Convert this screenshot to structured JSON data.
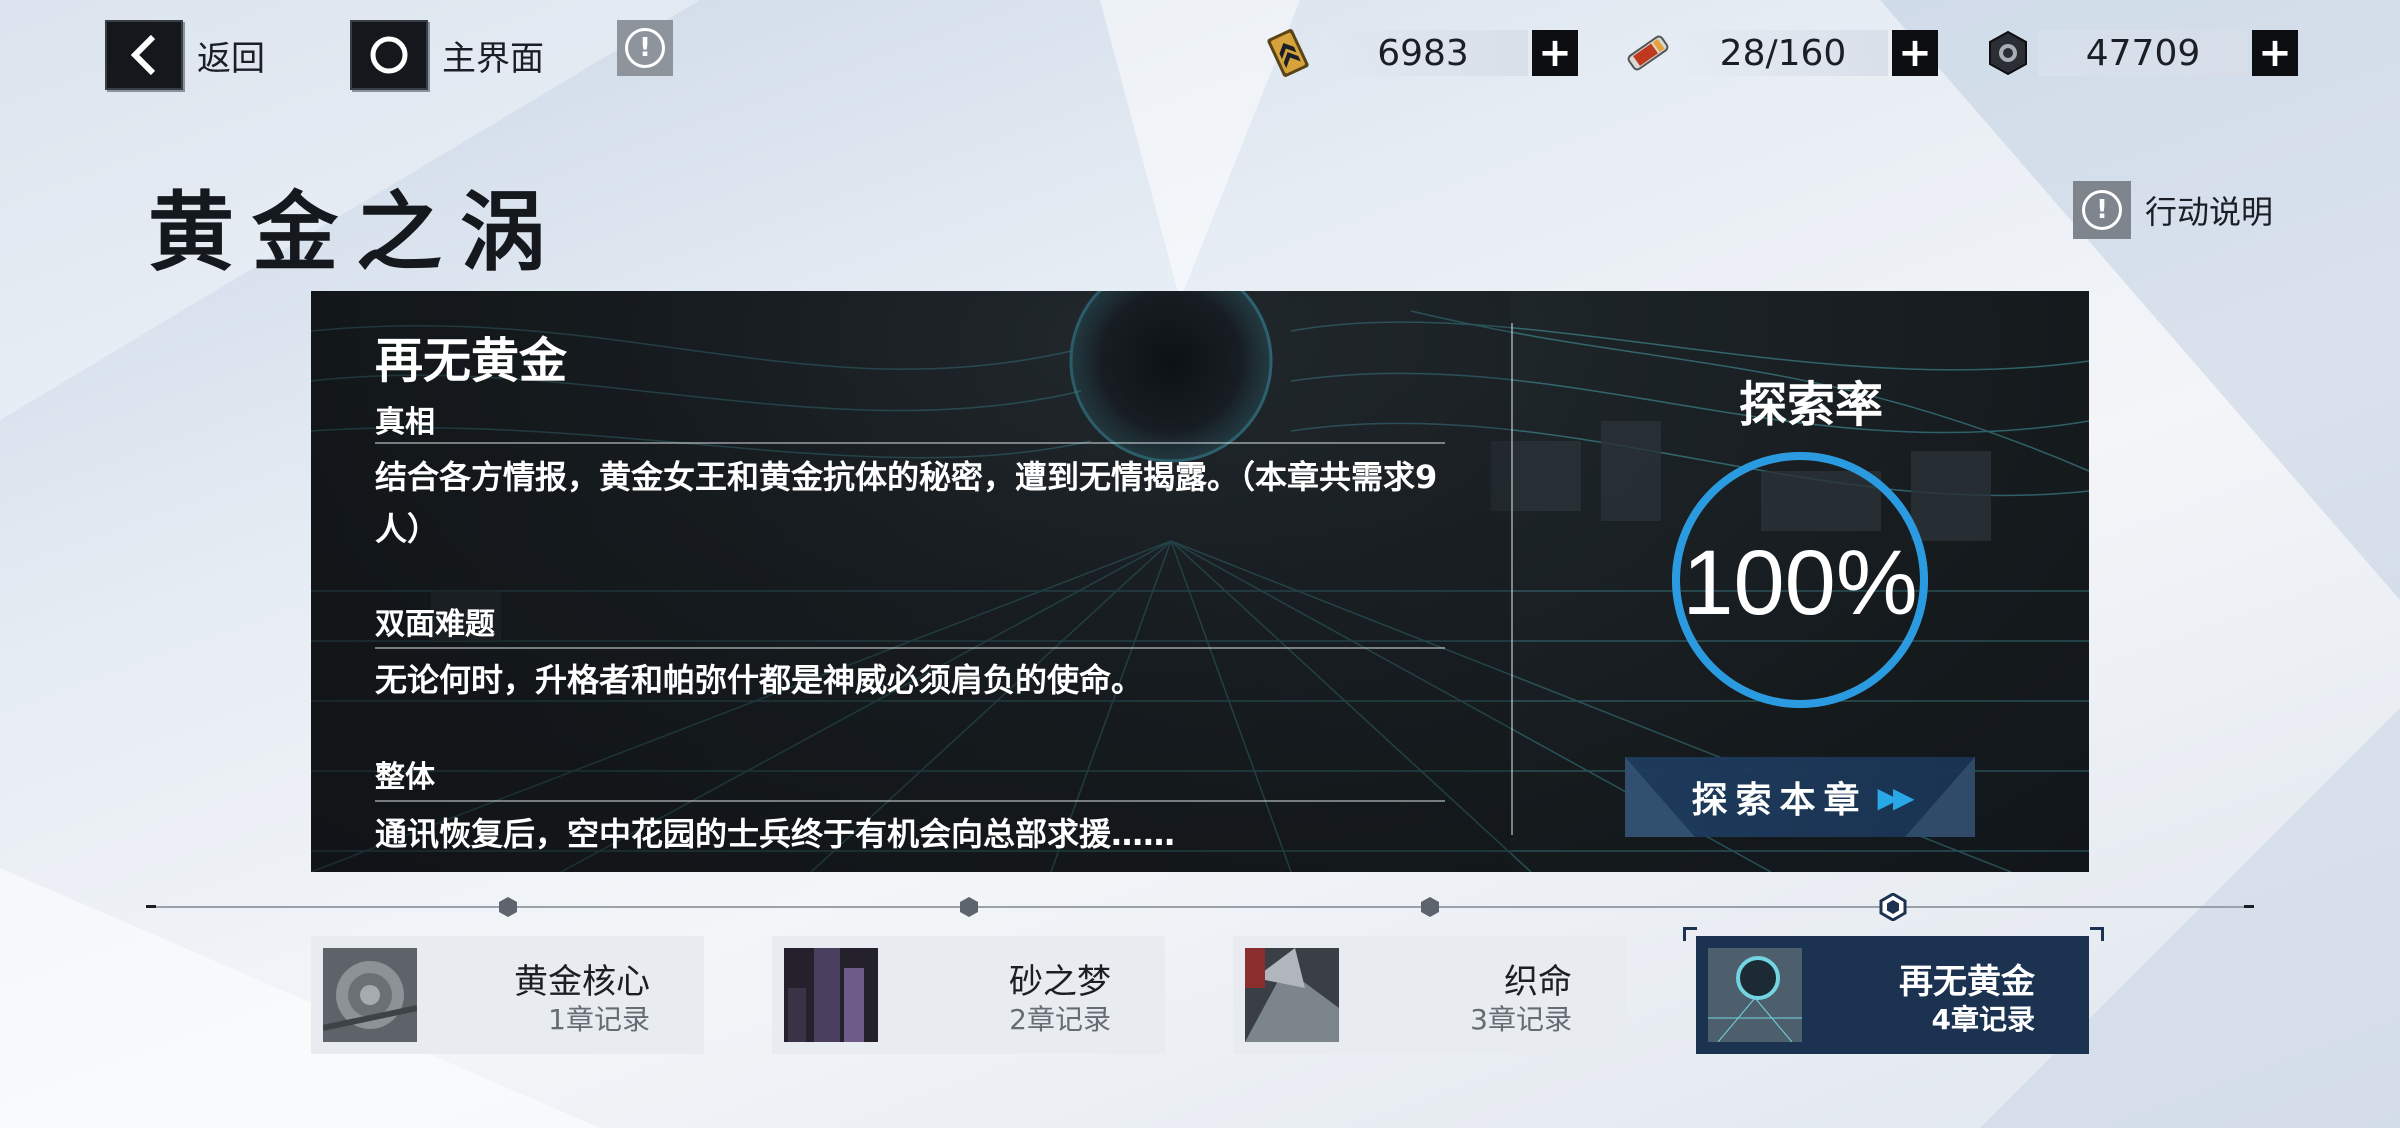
{
  "header": {
    "back_label": "返回",
    "home_label": "主界面",
    "resources": [
      {
        "icon": "gold-card-icon",
        "value": "6983"
      },
      {
        "icon": "energy-tube-icon",
        "value": "28/160"
      },
      {
        "icon": "gear-nut-icon",
        "value": "47709"
      }
    ]
  },
  "page": {
    "title": "黄金之涡",
    "help_label": "行动说明"
  },
  "chapter_panel": {
    "title": "再无黄金",
    "sections": [
      {
        "heading": "真相",
        "text": "结合各方情报，黄金女王和黄金抗体的秘密，遭到无情揭露。（本章共需求9人）"
      },
      {
        "heading": "双面难题",
        "text": "无论何时，升格者和帕弥什都是神威必须肩负的使命。"
      },
      {
        "heading": "整体",
        "text": "通讯恢复后，空中花园的士兵终于有机会向总部求援……"
      }
    ],
    "exploration_label": "探索率",
    "exploration_value": "100%",
    "exploration_fraction": 1.0,
    "explore_button_label": "探索本章",
    "accent_color": "#2a9be0"
  },
  "chapters": [
    {
      "name": "黄金核心",
      "records": "1章记录",
      "active": false
    },
    {
      "name": "砂之梦",
      "records": "2章记录",
      "active": false
    },
    {
      "name": "织命",
      "records": "3章记录",
      "active": false
    },
    {
      "name": "再无黄金",
      "records": "4章记录",
      "active": true
    }
  ]
}
